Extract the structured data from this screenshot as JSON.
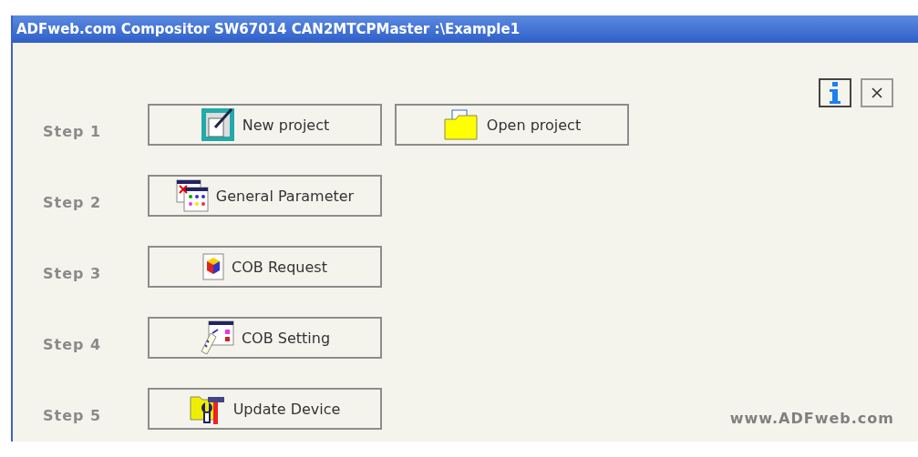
{
  "window": {
    "title": "ADFweb.com Compositor SW67014 CAN2MTCPMaster :\\Example1"
  },
  "steps": [
    {
      "label": "Step 1",
      "buttons": [
        {
          "label": "New project",
          "kind": "new"
        },
        {
          "label": "Open project",
          "kind": "open"
        }
      ]
    },
    {
      "label": "Step 2",
      "buttons": [
        {
          "label": "General Parameter",
          "kind": "params"
        }
      ]
    },
    {
      "label": "Step 3",
      "buttons": [
        {
          "label": "COB Request",
          "kind": "request"
        }
      ]
    },
    {
      "label": "Step 4",
      "buttons": [
        {
          "label": "COB Setting",
          "kind": "setting"
        }
      ]
    },
    {
      "label": "Step 5",
      "buttons": [
        {
          "label": "Update Device",
          "kind": "update"
        }
      ]
    }
  ],
  "footer": "www.ADFweb.com"
}
